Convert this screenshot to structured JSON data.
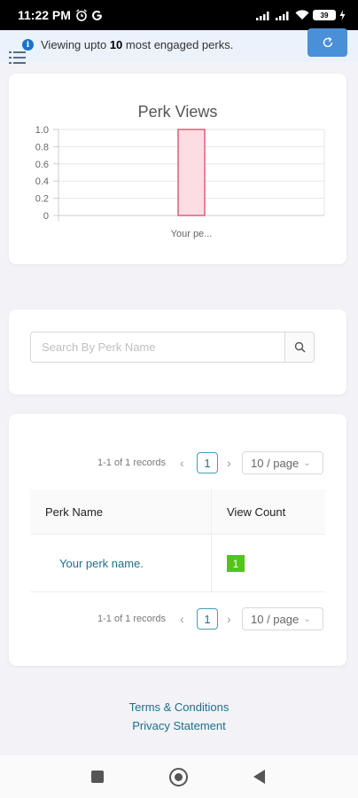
{
  "status_bar": {
    "time": "11:22 PM",
    "left_icons": [
      "alarm-icon",
      "google-icon"
    ],
    "right_icons": [
      "signal-icon",
      "signal-icon",
      "wifi-icon",
      "battery-icon",
      "charging-icon"
    ],
    "battery_level": "39"
  },
  "info_bar": {
    "text_before": "Viewing upto ",
    "count": "10",
    "text_after": " most engaged perks.",
    "refresh_icon": "refresh-icon",
    "menu_icon": "menu-list-icon"
  },
  "chart_data": {
    "type": "bar",
    "title": "Perk Views",
    "categories": [
      "Your pe..."
    ],
    "values": [
      1
    ],
    "ylim": [
      0,
      1.0
    ],
    "yticks": [
      "1.0",
      "0.8",
      "0.6",
      "0.4",
      "0.2",
      "0"
    ],
    "bar_fill": "#fbdde3",
    "bar_stroke": "#e85a7a",
    "grid": true
  },
  "search": {
    "placeholder": "Search By Perk Name",
    "icon": "search-icon"
  },
  "table": {
    "pagination_top": {
      "records": "1-1 of 1 records",
      "page": "1",
      "page_size": "10 / page"
    },
    "columns": [
      "Perk Name",
      "View Count"
    ],
    "rows": [
      {
        "name": "Your perk name.",
        "count": "1"
      }
    ],
    "pagination_bottom": {
      "records": "1-1 of 1 records",
      "page": "1",
      "page_size": "10 / page"
    }
  },
  "footer": {
    "terms": "Terms & Conditions",
    "privacy": "Privacy Statement"
  },
  "colors": {
    "accent": "#4a90d9",
    "link": "#1f6f8b",
    "badge_green": "#52c41a"
  }
}
